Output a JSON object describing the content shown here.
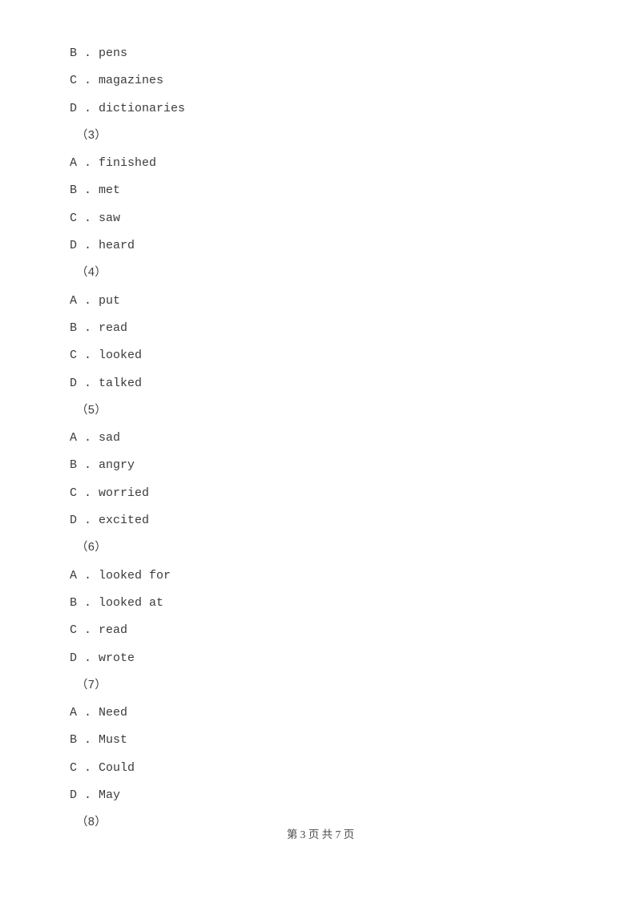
{
  "document": {
    "page_background": "#ffffff",
    "text_color": "#3c3c3c"
  },
  "body_lines": [
    {
      "kind": "option",
      "text": "B . pens"
    },
    {
      "kind": "option",
      "text": "C . magazines"
    },
    {
      "kind": "option",
      "text": "D . dictionaries"
    },
    {
      "kind": "qnum",
      "text": "（3）"
    },
    {
      "kind": "option",
      "text": "A . finished"
    },
    {
      "kind": "option",
      "text": "B . met"
    },
    {
      "kind": "option",
      "text": "C . saw"
    },
    {
      "kind": "option",
      "text": "D . heard"
    },
    {
      "kind": "qnum",
      "text": "（4）"
    },
    {
      "kind": "option",
      "text": "A . put"
    },
    {
      "kind": "option",
      "text": "B . read"
    },
    {
      "kind": "option",
      "text": "C . looked"
    },
    {
      "kind": "option",
      "text": "D . talked"
    },
    {
      "kind": "qnum",
      "text": "（5）"
    },
    {
      "kind": "option",
      "text": "A . sad"
    },
    {
      "kind": "option",
      "text": "B . angry"
    },
    {
      "kind": "option",
      "text": "C . worried"
    },
    {
      "kind": "option",
      "text": "D . excited"
    },
    {
      "kind": "qnum",
      "text": "（6）"
    },
    {
      "kind": "option",
      "text": "A . looked for"
    },
    {
      "kind": "option",
      "text": "B . looked at"
    },
    {
      "kind": "option",
      "text": "C . read"
    },
    {
      "kind": "option",
      "text": "D . wrote"
    },
    {
      "kind": "qnum",
      "text": "（7）"
    },
    {
      "kind": "option",
      "text": "A . Need"
    },
    {
      "kind": "option",
      "text": "B . Must"
    },
    {
      "kind": "option",
      "text": "C . Could"
    },
    {
      "kind": "option",
      "text": "D . May"
    },
    {
      "kind": "qnum",
      "text": "（8）"
    }
  ],
  "footer": {
    "page_label": "第 3 页 共 7 页",
    "current_page": "3",
    "total_pages": "7"
  }
}
